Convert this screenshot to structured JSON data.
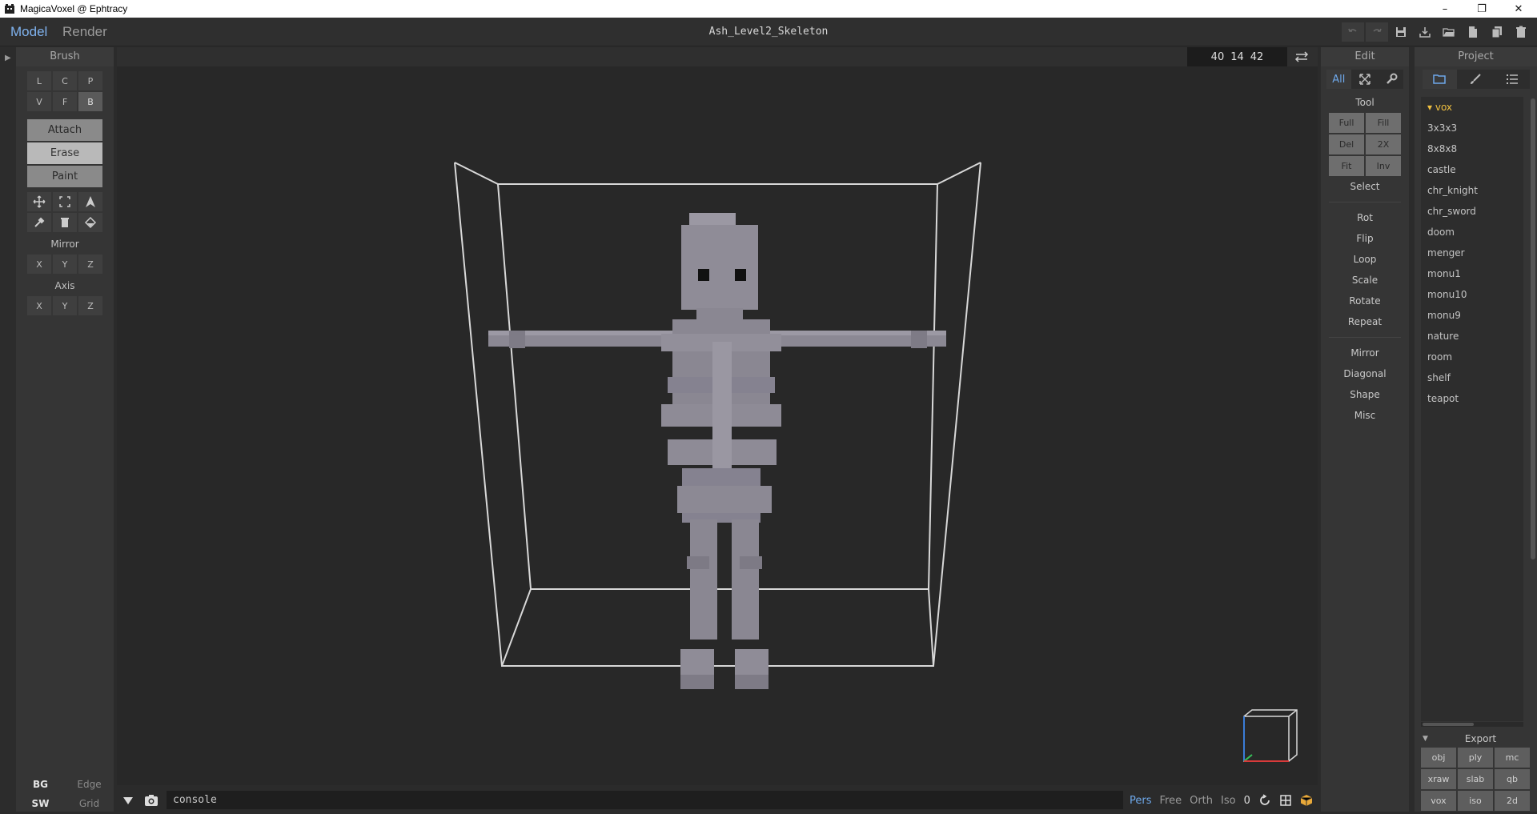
{
  "window": {
    "title": "MagicaVoxel @ Ephtracy"
  },
  "appbar": {
    "mode_tabs": [
      "Model",
      "Render"
    ],
    "document_title": "Ash_Level2_Skeleton",
    "icons": [
      "undo-icon",
      "redo-icon",
      "save-icon",
      "import-icon",
      "open-icon",
      "new-icon",
      "copy-icon",
      "delete-icon"
    ]
  },
  "brush": {
    "title": "Brush",
    "shape_row1": [
      "L",
      "C",
      "P"
    ],
    "shape_row2": [
      "V",
      "F",
      "B"
    ],
    "active_shape": "B",
    "modes": [
      "Attach",
      "Erase",
      "Paint"
    ],
    "active_mode": "Erase",
    "mirror_label": "Mirror",
    "mirror_axes": [
      "X",
      "Y",
      "Z"
    ],
    "axis_label": "Axis",
    "axis_axes": [
      "X",
      "Y",
      "Z"
    ]
  },
  "bottom_left": {
    "row1": [
      "BG",
      "Edge"
    ],
    "row2": [
      "SW",
      "Grid"
    ]
  },
  "viewport": {
    "coords": [
      "40",
      "14",
      "42"
    ]
  },
  "bottombar": {
    "console_text": "console",
    "view_modes": [
      "Pers",
      "Free",
      "Orth",
      "Iso"
    ],
    "active_view": "Pers",
    "value": "0"
  },
  "edit": {
    "title": "Edit",
    "tabs": [
      "All"
    ],
    "tool_label": "Tool",
    "tool_buttons": [
      "Full",
      "Fill",
      "Del",
      "2X",
      "Fit",
      "Inv"
    ],
    "select_label": "Select",
    "group1": [
      "Rot",
      "Flip",
      "Loop",
      "Scale",
      "Rotate",
      "Repeat"
    ],
    "group2": [
      "Mirror",
      "Diagonal",
      "Shape",
      "Misc"
    ]
  },
  "project": {
    "title": "Project",
    "folder": "vox",
    "files": [
      "3x3x3",
      "8x8x8",
      "castle",
      "chr_knight",
      "chr_sword",
      "doom",
      "menger",
      "monu1",
      "monu10",
      "monu9",
      "nature",
      "room",
      "shelf",
      "teapot"
    ],
    "export_label": "Export",
    "export_formats": [
      "obj",
      "ply",
      "mc",
      "xraw",
      "slab",
      "qb",
      "vox",
      "iso",
      "2d"
    ]
  },
  "colors": {
    "accent": "#6ea8ea",
    "folder": "#f0c040",
    "bbox": "#d8d8d8",
    "voxel": "#8f8c97"
  }
}
